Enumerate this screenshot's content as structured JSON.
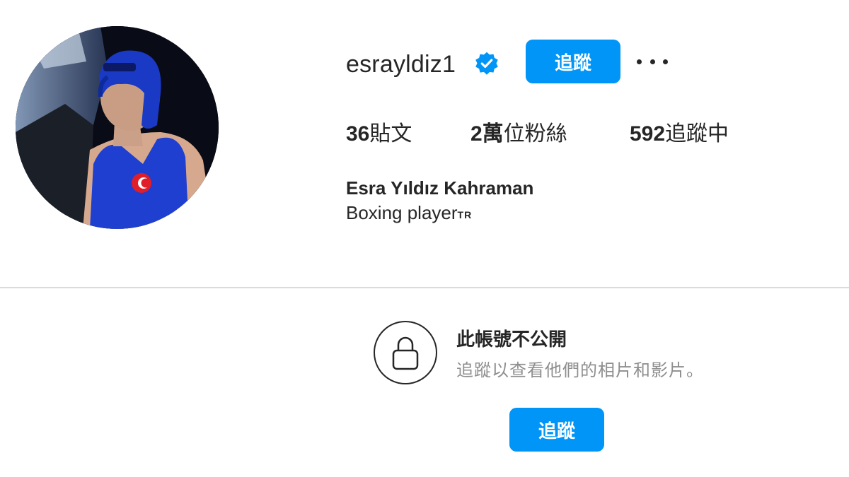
{
  "profile": {
    "username": "esrayldiz1",
    "verified": true,
    "follow_label": "追蹤",
    "more_icon": "more-horizontal-icon",
    "stats": {
      "posts_count": "36",
      "posts_label": "貼文",
      "followers_count": "2萬",
      "followers_label": "位粉絲",
      "following_count": "592",
      "following_label": "追蹤中"
    },
    "full_name": "Esra Yıldız Kahraman",
    "bio_text": "Boxing player",
    "bio_flag": "TR"
  },
  "private_notice": {
    "icon": "lock-icon",
    "title": "此帳號不公開",
    "subtitle": "追蹤以查看他們的相片和影片。",
    "follow_label": "追蹤"
  },
  "colors": {
    "accent": "#0095f6",
    "text_primary": "#262626",
    "text_secondary": "#8e8e8e",
    "divider": "#dbdbdb"
  }
}
